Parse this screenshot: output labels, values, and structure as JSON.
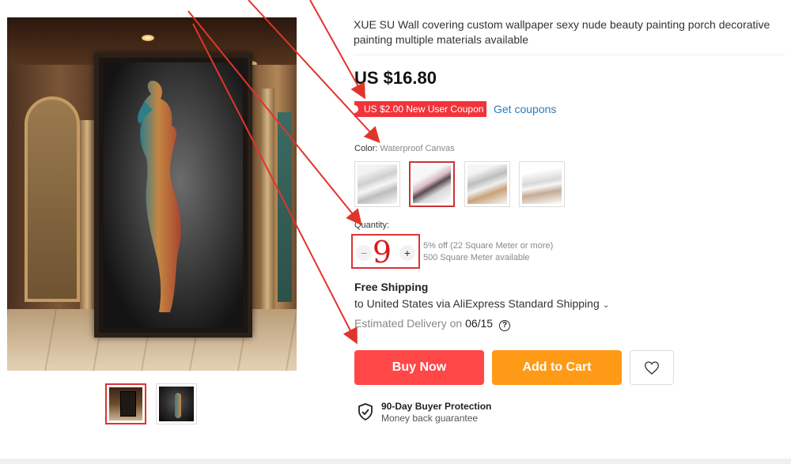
{
  "product": {
    "title": "XUE SU Wall covering custom wallpaper sexy nude beauty painting porch decorative painting multiple materials available",
    "price": "US $16.80",
    "coupon_text": "US $2.00 New User Coupon",
    "get_coupons_label": "Get coupons"
  },
  "color": {
    "label": "Color:",
    "selected_value": "Waterproof Canvas",
    "swatches": [
      "swatch-1",
      "swatch-2",
      "swatch-3",
      "swatch-4"
    ],
    "selected_index": 1
  },
  "quantity": {
    "label": "Quantity:",
    "value": "9",
    "minus": "−",
    "plus": "+",
    "discount_note": "5% off (22 Square Meter or more)",
    "available_note": "500 Square Meter available"
  },
  "shipping": {
    "title": "Free Shipping",
    "line": "to United States via AliExpress Standard Shipping",
    "chevron": "⌄",
    "delivery_prefix": "Estimated Delivery on",
    "delivery_date": "06/15",
    "help_glyph": "?"
  },
  "actions": {
    "buy_now": "Buy Now",
    "add_to_cart": "Add to Cart"
  },
  "protection": {
    "title": "90-Day Buyer Protection",
    "subtitle": "Money back guarantee"
  },
  "gallery": {
    "thumbnails": [
      "room-view",
      "close-up"
    ],
    "active_index": 0
  },
  "colors": {
    "buy_now": "#ff4747",
    "add_to_cart": "#ff9a16",
    "coupon": "#f2333b",
    "link": "#2e7ab8",
    "annotation": "#e0352b"
  },
  "icons": {
    "wishlist": "heart-icon",
    "protection": "shield-check-icon",
    "help": "question-circle-icon"
  }
}
